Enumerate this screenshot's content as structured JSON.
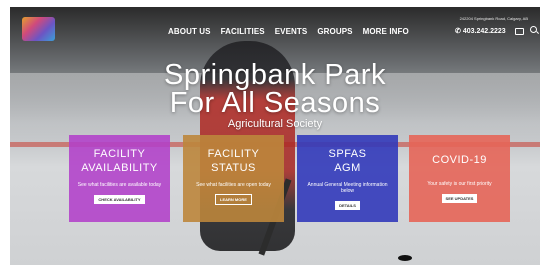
{
  "header": {
    "logo_icon": "organization-logo",
    "nav": [
      "ABOUT US",
      "FACILITIES",
      "EVENTS",
      "GROUPS",
      "MORE INFO"
    ],
    "address": "242204 Springbank Road, Calgary, AB",
    "phone": "403.242.2223",
    "phone_icon": "phone-icon",
    "mail_icon": "mail-icon",
    "search_icon": "search-icon"
  },
  "hero": {
    "line1": "Springbank Park",
    "line2": "For All Seasons",
    "subtitle": "Agricultural Society"
  },
  "cards": [
    {
      "title1": "FACILITY",
      "title2": "AVAILABILITY",
      "text": "See what facilities are available today",
      "button": "CHECK AVAILABILITY",
      "color": "#b240c9"
    },
    {
      "title1": "FACILITY",
      "title2": "STATUS",
      "text": "See what facilities are open today",
      "button": "LEARN MORE",
      "color": "#bc863c"
    },
    {
      "title1": "SPFAS",
      "title2": "AGM",
      "text": "Annual General Meeting information below",
      "button": "DETAILS",
      "color": "#323aba"
    },
    {
      "title1": "COVID-19",
      "title2": "",
      "text": "Your safety is our first priority",
      "button": "SEE UPDATES",
      "color": "#e56558"
    }
  ]
}
